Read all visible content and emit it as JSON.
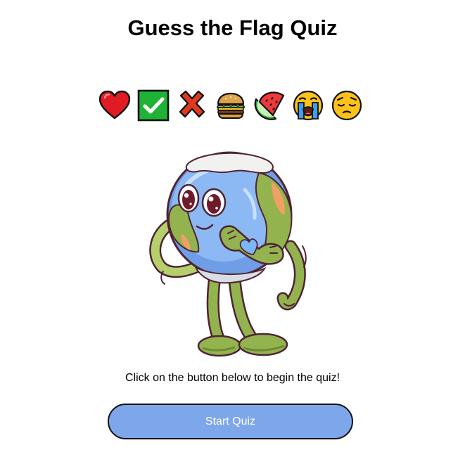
{
  "page": {
    "title": "Guess the Flag Quiz",
    "instruction": "Click on the button below to begin the quiz!",
    "start_button_label": "Start Quiz"
  },
  "emoji_row": [
    {
      "name": "red-heart",
      "glyph": "❤️"
    },
    {
      "name": "check-mark-button",
      "glyph": "✅"
    },
    {
      "name": "cross-mark",
      "glyph": "❌"
    },
    {
      "name": "hamburger",
      "glyph": "🍔"
    },
    {
      "name": "watermelon",
      "glyph": "🍉"
    },
    {
      "name": "loudly-crying-face",
      "glyph": "😭"
    },
    {
      "name": "pensive-face",
      "glyph": "😔"
    }
  ],
  "illustration": {
    "name": "earth-globe-mascot-making-heart-hands"
  },
  "colors": {
    "button_fill": "#7ea6ea",
    "button_text": "#ffffff",
    "button_border": "#111111",
    "title_text": "#000000"
  }
}
